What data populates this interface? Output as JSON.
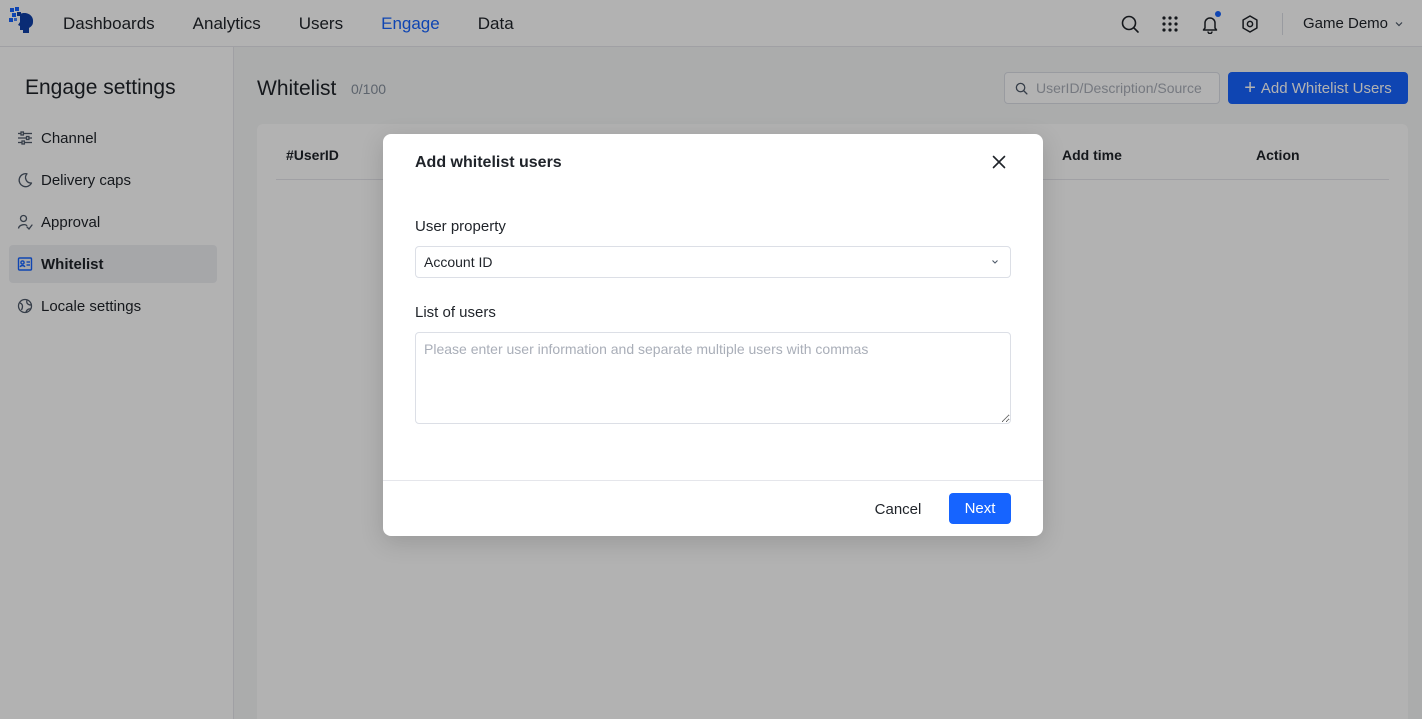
{
  "colors": {
    "accent": "#1664ff",
    "text": "#1f2329",
    "muted": "#86909c"
  },
  "topbar": {
    "logo_icon": "brain-cube-logo-icon",
    "nav": [
      {
        "label": "Dashboards",
        "active": false
      },
      {
        "label": "Analytics",
        "active": false
      },
      {
        "label": "Users",
        "active": false
      },
      {
        "label": "Engage",
        "active": true
      },
      {
        "label": "Data",
        "active": false
      }
    ],
    "icons": [
      "search-icon",
      "apps-grid-icon",
      "bell-icon",
      "settings-icon"
    ],
    "project": "Game Demo"
  },
  "sidebar": {
    "title": "Engage settings",
    "items": [
      {
        "label": "Channel",
        "icon": "sliders-icon",
        "active": false
      },
      {
        "label": "Delivery caps",
        "icon": "moon-icon",
        "active": false
      },
      {
        "label": "Approval",
        "icon": "user-check-icon",
        "active": false
      },
      {
        "label": "Whitelist",
        "icon": "id-list-icon",
        "active": true
      },
      {
        "label": "Locale settings",
        "icon": "globe-icon",
        "active": false
      }
    ]
  },
  "main": {
    "title": "Whitelist",
    "count": "0/100",
    "search_placeholder": "UserID/Description/Source",
    "add_button": "Add Whitelist Users",
    "table": {
      "columns": [
        "#UserID",
        "Add time",
        "Action"
      ]
    }
  },
  "modal": {
    "title": "Add whitelist users",
    "user_property_label": "User property",
    "user_property_value": "Account ID",
    "list_label": "List of users",
    "list_placeholder": "Please enter user information and separate multiple users with commas",
    "cancel": "Cancel",
    "next": "Next"
  }
}
